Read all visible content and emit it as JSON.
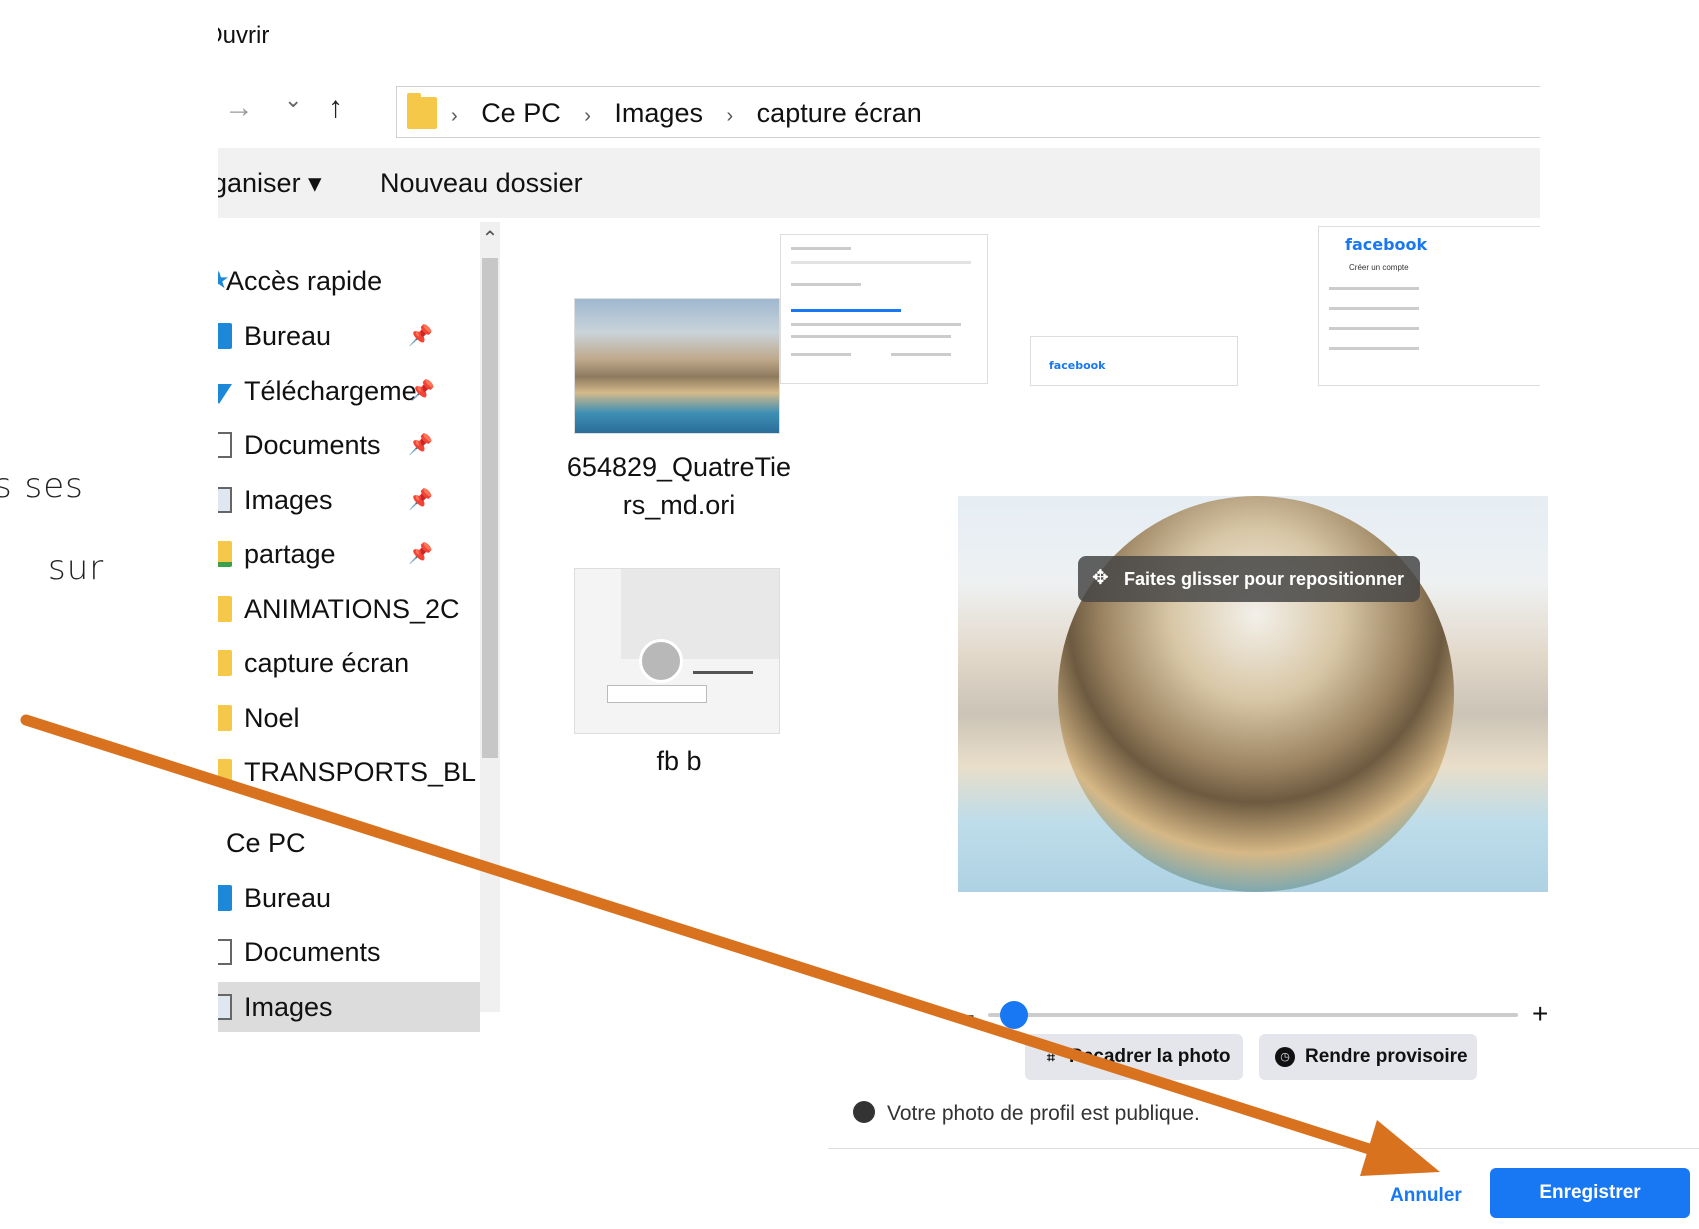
{
  "background_text": {
    "line1": "s ses",
    "line2": "sur"
  },
  "dialog": {
    "title": "Ouvrir",
    "nav": {
      "forward": "→",
      "dropdown": "⌄",
      "up": "↑"
    },
    "breadcrumbs": [
      "Ce PC",
      "Images",
      "capture écran"
    ],
    "toolbar": {
      "organize": "ganiser ▾",
      "new_folder": "Nouveau dossier"
    },
    "sidebar": [
      {
        "label": "Accès rapide",
        "icon": "star-icon"
      },
      {
        "label": "Bureau",
        "icon": "desktop-icon",
        "pinned": true
      },
      {
        "label": "Téléchargeme",
        "icon": "download-icon",
        "pinned": true
      },
      {
        "label": "Documents",
        "icon": "documents-icon",
        "pinned": true
      },
      {
        "label": "Images",
        "icon": "images-icon",
        "pinned": true
      },
      {
        "label": "partage",
        "icon": "shared-folder-icon",
        "pinned": true
      },
      {
        "label": "ANIMATIONS_2C",
        "icon": "folder-icon"
      },
      {
        "label": "capture écran",
        "icon": "folder-icon"
      },
      {
        "label": "Noel",
        "icon": "folder-icon"
      },
      {
        "label": "TRANSPORTS_BL",
        "icon": "folder-icon"
      },
      {
        "label": "Ce PC",
        "icon": "pc-icon"
      },
      {
        "label": "Bureau",
        "icon": "desktop-icon"
      },
      {
        "label": "Documents",
        "icon": "documents-icon"
      },
      {
        "label": "Images",
        "icon": "images-icon"
      }
    ],
    "files": [
      {
        "label_line1": "654829_QuatreTie",
        "label_line2": "rs_md.ori"
      },
      {
        "label_line1": "fb b",
        "label_line2": ""
      }
    ],
    "mini_brand": "facebook",
    "mini_title": "Créer un compte"
  },
  "fb_panel": {
    "drag_hint": "Faites glisser pour repositionner",
    "zoom_minus": "–",
    "zoom_plus": "+",
    "zoom_level": 0.03,
    "crop_button": "Recadrer la photo",
    "temporary_button": "Rendre provisoire",
    "public_note": "Votre photo de profil est publique.",
    "cancel": "Annuler",
    "save": "Enregistrer"
  },
  "colors": {
    "accent": "#1877f2",
    "arrow": "#d9721f",
    "folder": "#f5c84a"
  }
}
